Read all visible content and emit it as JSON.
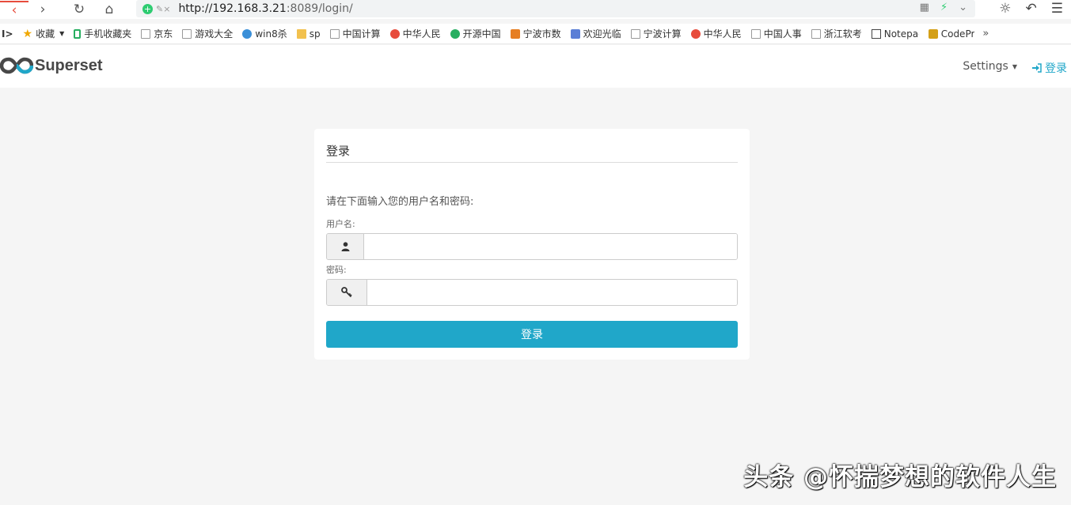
{
  "browser": {
    "url_host": "http://192.168.3.21",
    "url_rest": ":8089/login/"
  },
  "bookmarks": [
    {
      "label": "收藏",
      "icon": "star-icon"
    },
    {
      "label": "手机收藏夹",
      "icon": "phone-icon"
    },
    {
      "label": "京东",
      "icon": "page-icon"
    },
    {
      "label": "游戏大全",
      "icon": "page-icon"
    },
    {
      "label": "win8杀",
      "icon": "globe-icon"
    },
    {
      "label": "sp",
      "icon": "folder-icon"
    },
    {
      "label": "中国计算",
      "icon": "page-icon"
    },
    {
      "label": "中华人民",
      "icon": "gear-logo-icon"
    },
    {
      "label": "开源中国",
      "icon": "oschina-icon"
    },
    {
      "label": "宁波市数",
      "icon": "flame-icon"
    },
    {
      "label": "欢迎光临",
      "icon": "site-icon"
    },
    {
      "label": "宁波计算",
      "icon": "page-icon"
    },
    {
      "label": "中华人民",
      "icon": "emblem-icon"
    },
    {
      "label": "中国人事",
      "icon": "page-icon"
    },
    {
      "label": "浙江软考",
      "icon": "page-icon"
    },
    {
      "label": "Notepad",
      "icon": "notepad-icon"
    },
    {
      "label": "CodePr",
      "icon": "codepro-icon"
    }
  ],
  "app": {
    "brand": "Superset",
    "settings_label": "Settings",
    "login_label": "登录"
  },
  "login_card": {
    "title": "登录",
    "prompt": "请在下面输入您的用户名和密码:",
    "username_label": "用户名:",
    "username_value": "",
    "password_label": "密码:",
    "password_value": "",
    "submit_label": "登录"
  },
  "watermark": "头条 @怀揣梦想的软件人生"
}
